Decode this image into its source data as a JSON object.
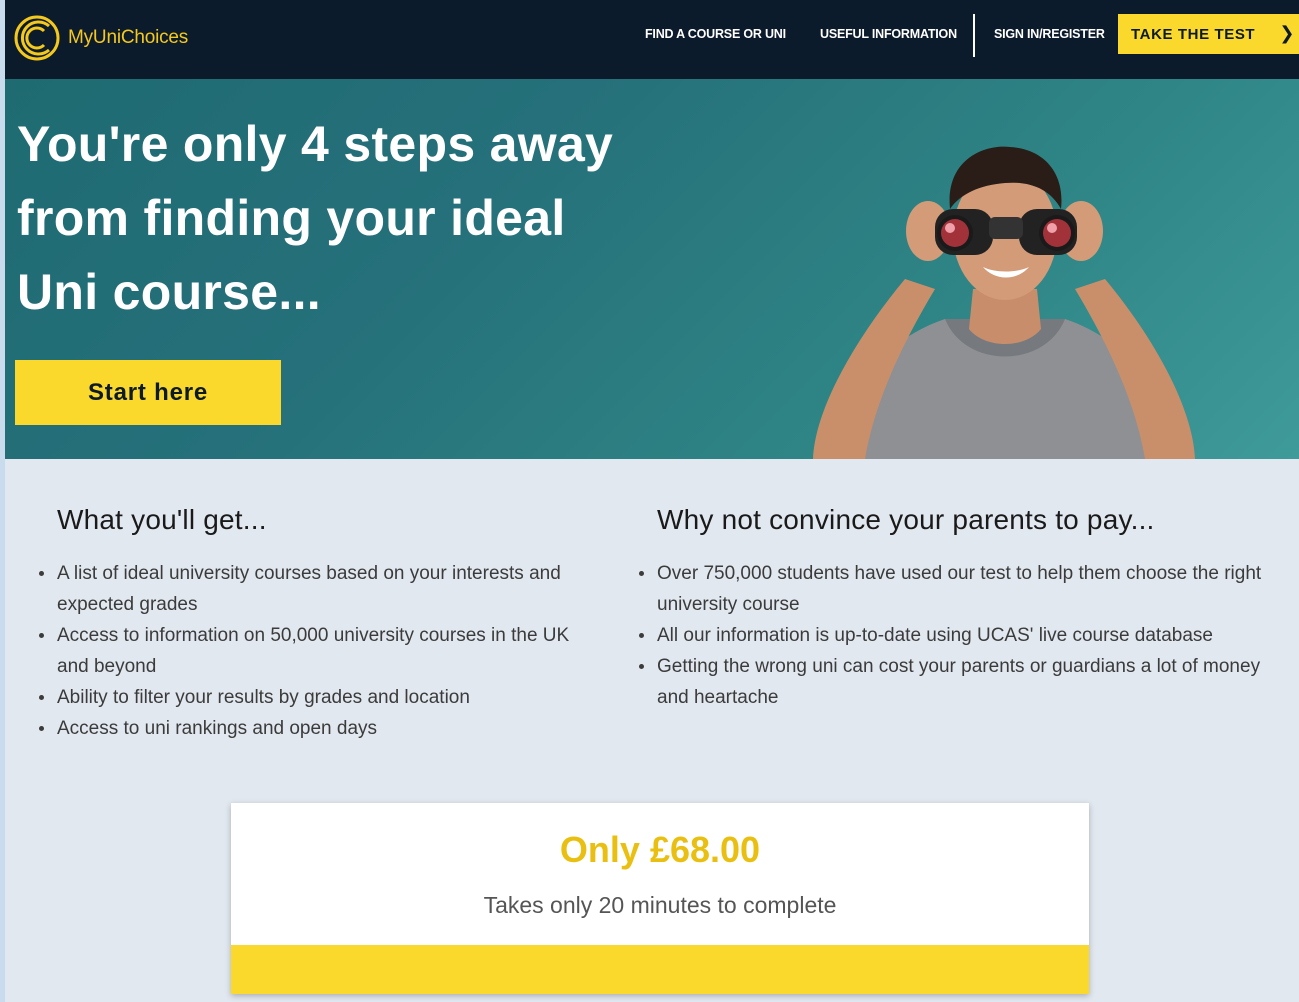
{
  "brand": {
    "name": "MyUniChoices",
    "accent": "#f4c81c",
    "nav_bg": "#0c1b2c",
    "cta_yellow": "#fad82c"
  },
  "nav": {
    "find": "FIND A COURSE OR UNI",
    "info": "USEFUL INFORMATION",
    "signin": "SIGN IN/REGISTER",
    "cta": "TAKE THE TEST",
    "cta_icon": "chevron-right-icon"
  },
  "hero": {
    "line1": "You're only 4 steps away",
    "line2": "from finding your ideal",
    "line3": "Uni course...",
    "button": "Start here",
    "image": "man-with-binoculars"
  },
  "benefits": {
    "title": "What you'll get...",
    "items": [
      "A list of ideal university courses based on your interests and expected grades",
      "Access to information on 50,000 university courses in the UK and beyond",
      "Ability to filter your results by grades and location",
      "Access to uni rankings and open days"
    ]
  },
  "parents": {
    "title": "Why not convince your parents to pay...",
    "items": [
      "Over 750,000 students have used our test to help them choose the right university course",
      "All our information is up-to-date using UCAS' live course database",
      "Getting the wrong uni can cost your parents or guardians a lot of money and heartache"
    ]
  },
  "pricing": {
    "price": "Only £68.00",
    "duration": "Takes only 20 minutes to complete"
  }
}
